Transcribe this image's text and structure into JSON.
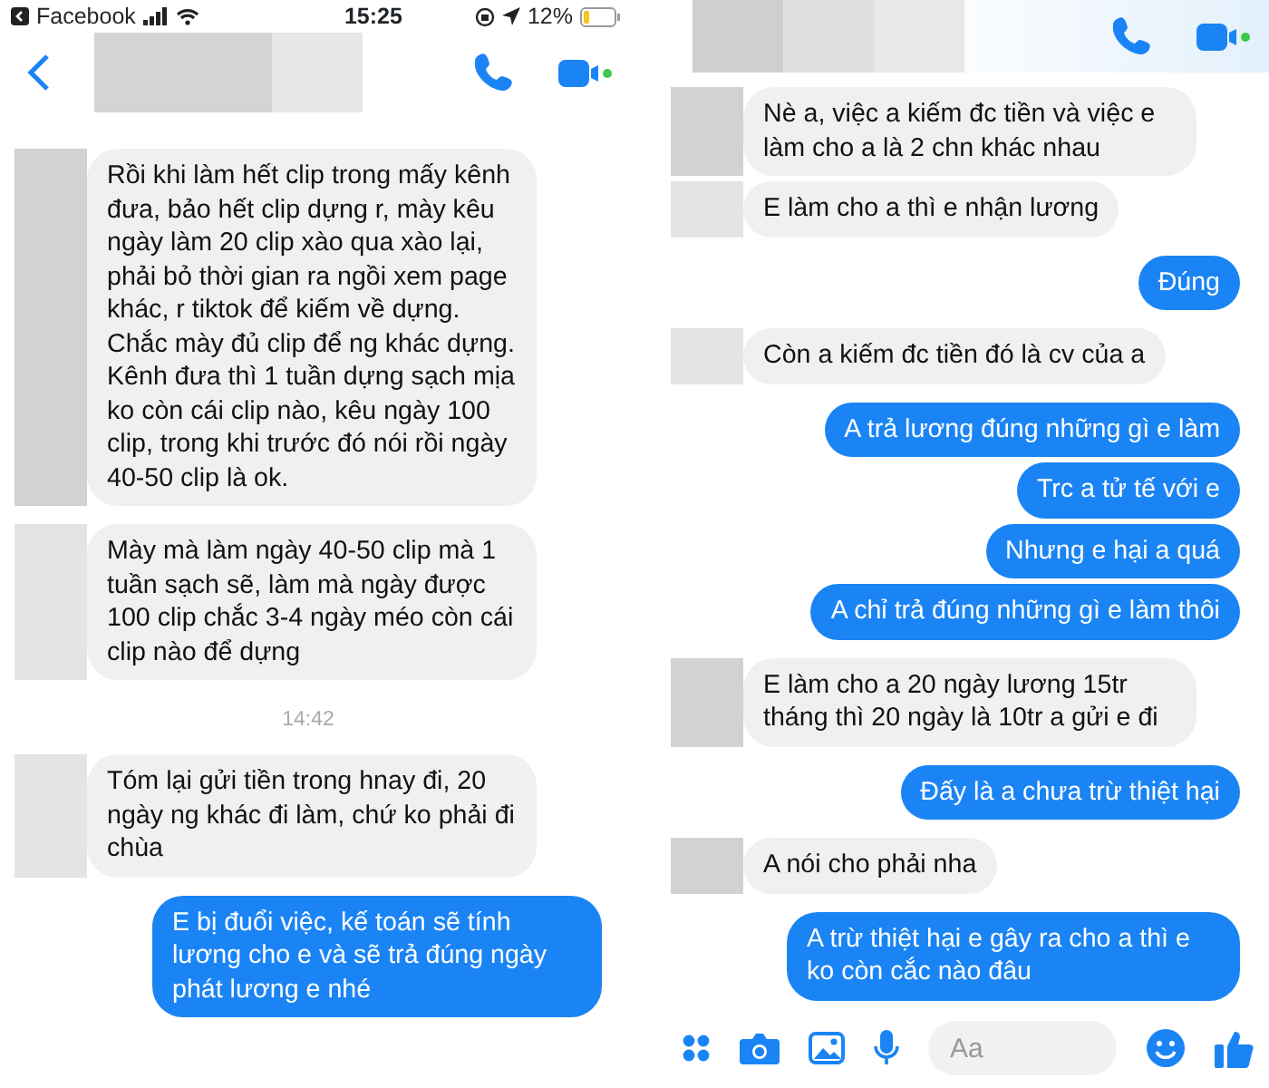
{
  "panels": [
    {
      "status_bar": {
        "app": "Facebook",
        "time": "15:25",
        "battery": "12%"
      },
      "messages": [
        {
          "kind": "incoming",
          "text": "Rồi khi làm hết clip trong mấy kênh đưa, bảo hết clip dựng r, mày kêu ngày làm 20 clip xào qua xào lại, phải bỏ thời gian ra ngồi xem page khác, r tiktok để kiếm về dựng. Chắc mày đủ clip để ng khác dựng. Kênh đưa thì 1 tuần dựng sạch mịa ko còn cái clip nào, kêu ngày 100 clip, trong khi trước đó nói rồi ngày 40-50 clip là ok."
        },
        {
          "kind": "incoming",
          "text": "Mày mà làm ngày 40-50 clip mà 1 tuần sạch sẽ, làm mà ngày được 100 clip chắc 3-4 ngày méo còn cái clip nào để dựng"
        },
        {
          "kind": "time",
          "text": "14:42"
        },
        {
          "kind": "incoming",
          "text": "Tóm lại gửi tiền trong hnay đi, 20 ngày ng khác đi làm, chứ ko phải đi chùa"
        },
        {
          "kind": "outgoing",
          "text": "E bị đuổi việc, kế toán sẽ tính lương cho e và sẽ trả đúng ngày phát lương e nhé"
        }
      ]
    },
    {
      "messages": [
        {
          "kind": "incoming",
          "text": "Nè a, việc a kiếm đc tiền và việc e làm cho a là 2 chn khác nhau"
        },
        {
          "kind": "incoming",
          "text": "E làm cho a thì e nhận lương"
        },
        {
          "kind": "outgoing",
          "text": "Đúng"
        },
        {
          "kind": "incoming",
          "text": "Còn a kiếm đc tiền đó là cv của a"
        },
        {
          "kind": "outgoing",
          "text": "A trả lương đúng những gì e làm"
        },
        {
          "kind": "outgoing",
          "text": "Trc a tử tế với e"
        },
        {
          "kind": "outgoing",
          "text": "Nhưng e hại a quá"
        },
        {
          "kind": "outgoing",
          "text": "A chỉ trả đúng những gì e làm thôi"
        },
        {
          "kind": "incoming",
          "text": "E làm cho a 20 ngày lương 15tr tháng thì 20 ngày là 10tr a gửi e đi"
        },
        {
          "kind": "outgoing",
          "text": "Đấy là a chưa trừ thiệt hại"
        },
        {
          "kind": "incoming",
          "text": "A nói cho phải nha"
        },
        {
          "kind": "outgoing",
          "text": "A trừ thiệt hại e gây ra cho a thì e ko còn cắc nào đâu"
        }
      ],
      "composer": {
        "placeholder": "Aa"
      }
    }
  ]
}
